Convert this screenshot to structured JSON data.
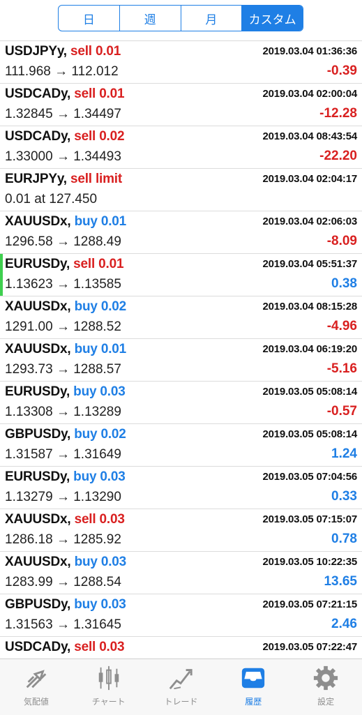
{
  "segments": [
    {
      "label": "日",
      "active": false
    },
    {
      "label": "週",
      "active": false
    },
    {
      "label": "月",
      "active": false
    },
    {
      "label": "カスタム",
      "active": true
    }
  ],
  "trades": [
    {
      "symbol": "USDJPYy",
      "side": "sell",
      "action": "sell 0.01",
      "time": "2019.03.04 01:36:36",
      "prices": "111.968 → 112.012",
      "profit": "-0.39",
      "highlight": false
    },
    {
      "symbol": "USDCADy",
      "side": "sell",
      "action": "sell 0.01",
      "time": "2019.03.04 02:00:04",
      "prices": "1.32845 → 1.34497",
      "profit": "-12.28",
      "highlight": false
    },
    {
      "symbol": "USDCADy",
      "side": "sell",
      "action": "sell 0.02",
      "time": "2019.03.04 08:43:54",
      "prices": "1.33000 → 1.34493",
      "profit": "-22.20",
      "highlight": false
    },
    {
      "symbol": "EURJPYy",
      "side": "sell",
      "action": "sell limit",
      "time": "2019.03.04 02:04:17",
      "prices": "0.01 at 127.450",
      "profit": "",
      "highlight": false
    },
    {
      "symbol": "XAUUSDx",
      "side": "buy",
      "action": "buy 0.01",
      "time": "2019.03.04 02:06:03",
      "prices": "1296.58 → 1288.49",
      "profit": "-8.09",
      "highlight": false
    },
    {
      "symbol": "EURUSDy",
      "side": "sell",
      "action": "sell 0.01",
      "time": "2019.03.04 05:51:37",
      "prices": "1.13623 → 1.13585",
      "profit": "0.38",
      "highlight": true
    },
    {
      "symbol": "XAUUSDx",
      "side": "buy",
      "action": "buy 0.02",
      "time": "2019.03.04 08:15:28",
      "prices": "1291.00 → 1288.52",
      "profit": "-4.96",
      "highlight": false
    },
    {
      "symbol": "XAUUSDx",
      "side": "buy",
      "action": "buy 0.01",
      "time": "2019.03.04 06:19:20",
      "prices": "1293.73 → 1288.57",
      "profit": "-5.16",
      "highlight": false
    },
    {
      "symbol": "EURUSDy",
      "side": "buy",
      "action": "buy 0.03",
      "time": "2019.03.05 05:08:14",
      "prices": "1.13308 → 1.13289",
      "profit": "-0.57",
      "highlight": false
    },
    {
      "symbol": "GBPUSDy",
      "side": "buy",
      "action": "buy 0.02",
      "time": "2019.03.05 05:08:14",
      "prices": "1.31587 → 1.31649",
      "profit": "1.24",
      "highlight": false
    },
    {
      "symbol": "EURUSDy",
      "side": "buy",
      "action": "buy 0.03",
      "time": "2019.03.05 07:04:56",
      "prices": "1.13279 → 1.13290",
      "profit": "0.33",
      "highlight": false
    },
    {
      "symbol": "XAUUSDx",
      "side": "sell",
      "action": "sell 0.03",
      "time": "2019.03.05 07:15:07",
      "prices": "1286.18 → 1285.92",
      "profit": "0.78",
      "highlight": false
    },
    {
      "symbol": "XAUUSDx",
      "side": "buy",
      "action": "buy 0.03",
      "time": "2019.03.05 10:22:35",
      "prices": "1283.99 → 1288.54",
      "profit": "13.65",
      "highlight": false
    },
    {
      "symbol": "GBPUSDy",
      "side": "buy",
      "action": "buy 0.03",
      "time": "2019.03.05 07:21:15",
      "prices": "1.31563 → 1.31645",
      "profit": "2.46",
      "highlight": false
    },
    {
      "symbol": "USDCADy",
      "side": "sell",
      "action": "sell 0.03",
      "time": "2019.03.05 07:22:47",
      "prices": "",
      "profit": "",
      "highlight": false
    }
  ],
  "tabs": [
    {
      "label": "気配値",
      "icon": "quotes-icon",
      "active": false
    },
    {
      "label": "チャート",
      "icon": "chart-icon",
      "active": false
    },
    {
      "label": "トレード",
      "icon": "trade-icon",
      "active": false
    },
    {
      "label": "履歴",
      "icon": "history-icon",
      "active": true
    },
    {
      "label": "設定",
      "icon": "settings-icon",
      "active": false
    }
  ],
  "colors": {
    "accent": "#1f7fe5",
    "loss": "#d92020",
    "highlight": "#3fcf4f"
  }
}
